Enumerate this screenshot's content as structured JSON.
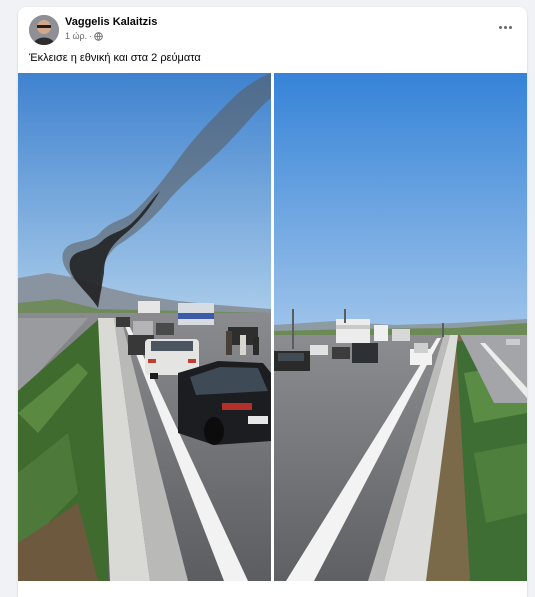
{
  "post": {
    "author": "Vaggelis Kalaitzis",
    "time": "1 ώρ.",
    "separator": "·",
    "text": "Έκλεισε η εθνική και στα 2 ρεύματα",
    "menu_icon": "more-horizontal-icon",
    "privacy_icon": "globe-icon"
  },
  "colors": {
    "sky": "#3a86d8",
    "smoke": "#2a2a2a",
    "road": "#6e6f73",
    "lane_line": "#f4f4f4",
    "shrubs": "#3d6b2f"
  }
}
